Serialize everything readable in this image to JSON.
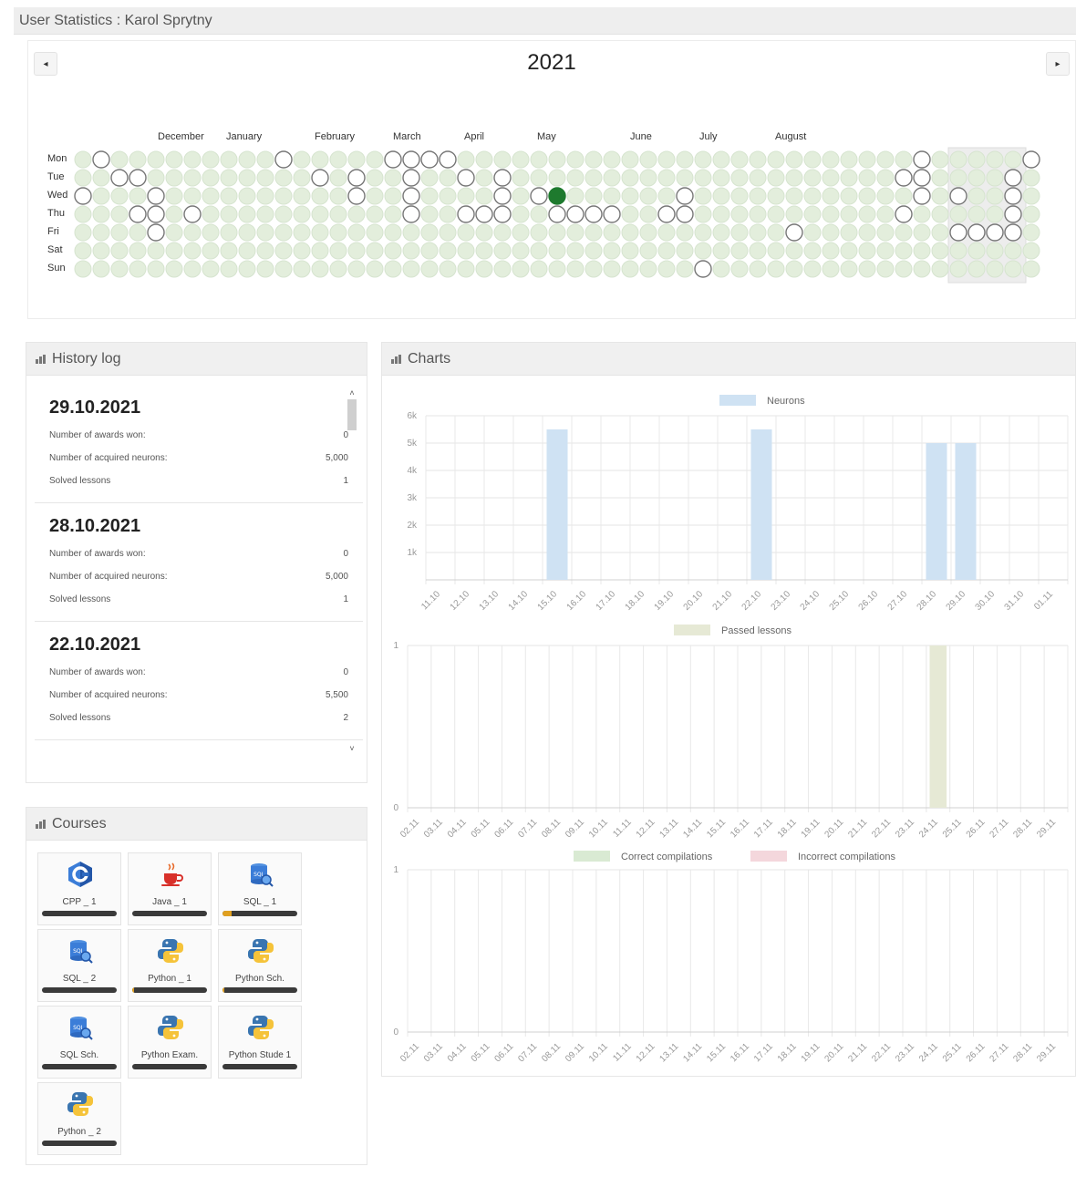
{
  "header": {
    "title": "User Statistics : Karol Sprytny"
  },
  "calendar": {
    "year": "2021",
    "prev_icon": "◂",
    "next_icon": "▸",
    "months": [
      "December",
      "January",
      "February",
      "March",
      "April",
      "May",
      "June",
      "July",
      "August"
    ],
    "days": [
      "Mon",
      "Tue",
      "Wed",
      "Thu",
      "Fri",
      "Sat",
      "Sun"
    ],
    "active_cells": [
      [
        1,
        0
      ],
      [
        2,
        1
      ],
      [
        3,
        1
      ],
      [
        0,
        2
      ],
      [
        4,
        2
      ],
      [
        3,
        3
      ],
      [
        4,
        3
      ],
      [
        6,
        3
      ],
      [
        4,
        4
      ],
      [
        11,
        0
      ],
      [
        13,
        1
      ],
      [
        15,
        1
      ],
      [
        15,
        2
      ],
      [
        17,
        0
      ],
      [
        18,
        0
      ],
      [
        19,
        0
      ],
      [
        20,
        0
      ],
      [
        18,
        1
      ],
      [
        18,
        2
      ],
      [
        18,
        3
      ],
      [
        21,
        1
      ],
      [
        23,
        1
      ],
      [
        23,
        2
      ],
      [
        21,
        3
      ],
      [
        22,
        3
      ],
      [
        23,
        3
      ],
      [
        25,
        2
      ],
      [
        26,
        3
      ],
      [
        27,
        3
      ],
      [
        28,
        3
      ],
      [
        29,
        3
      ],
      [
        33,
        2
      ],
      [
        32,
        3
      ],
      [
        33,
        3
      ],
      [
        34,
        6
      ],
      [
        39,
        4
      ],
      [
        45,
        1
      ],
      [
        46,
        0
      ],
      [
        46,
        1
      ],
      [
        46,
        2
      ],
      [
        45,
        3
      ],
      [
        48,
        2
      ],
      [
        48,
        4
      ],
      [
        49,
        4
      ],
      [
        50,
        4
      ],
      [
        51,
        1
      ],
      [
        51,
        2
      ],
      [
        51,
        3
      ],
      [
        51,
        4
      ],
      [
        52,
        0
      ]
    ],
    "highlight_cell": [
      26,
      2
    ],
    "colors": {
      "empty": "#e3eedc",
      "active_stroke": "#777777",
      "highlight": "#1e7a2e"
    }
  },
  "history": {
    "title": "History log",
    "entries": [
      {
        "date": "29.10.2021",
        "awards_label": "Number of awards won:",
        "awards": "0",
        "neurons_label": "Number of acquired neurons:",
        "neurons": "5,000",
        "lessons_label": "Solved lessons",
        "lessons": "1"
      },
      {
        "date": "28.10.2021",
        "awards_label": "Number of awards won:",
        "awards": "0",
        "neurons_label": "Number of acquired neurons:",
        "neurons": "5,000",
        "lessons_label": "Solved lessons",
        "lessons": "1"
      },
      {
        "date": "22.10.2021",
        "awards_label": "Number of awards won:",
        "awards": "0",
        "neurons_label": "Number of acquired neurons:",
        "neurons": "5,500",
        "lessons_label": "Solved lessons",
        "lessons": "2"
      }
    ],
    "scroll_up_icon": "˄",
    "scroll_down_icon": "˅"
  },
  "courses": {
    "title": "Courses",
    "items": [
      {
        "label": "CPP _ 1",
        "icon": "cpp-icon",
        "progress": 0
      },
      {
        "label": "Java _ 1",
        "icon": "java-icon",
        "progress": 0
      },
      {
        "label": "SQL _ 1",
        "icon": "sql-icon",
        "progress": 0.12
      },
      {
        "label": "SQL _ 2",
        "icon": "sql-icon",
        "progress": 0
      },
      {
        "label": "Python _ 1",
        "icon": "python-icon",
        "progress": 0.03
      },
      {
        "label": "Python Sch.",
        "icon": "python-icon",
        "progress": 0.03
      },
      {
        "label": "SQL Sch.",
        "icon": "sql-icon",
        "progress": 0
      },
      {
        "label": "Python Exam.",
        "icon": "python-icon",
        "progress": 0
      },
      {
        "label": "Python Stude 1",
        "icon": "python-icon",
        "progress": 0
      },
      {
        "label": "Python _ 2",
        "icon": "python-icon",
        "progress": 0
      }
    ]
  },
  "charts": {
    "title": "Charts"
  },
  "chart_data": [
    {
      "type": "bar",
      "series": [
        {
          "name": "Neurons",
          "color": "#cfe2f3",
          "values": [
            0,
            0,
            0,
            0,
            5500,
            0,
            0,
            0,
            0,
            0,
            0,
            5500,
            0,
            0,
            0,
            0,
            0,
            5000,
            5000,
            0,
            0,
            0
          ]
        }
      ],
      "categories": [
        "11.10",
        "12.10",
        "13.10",
        "14.10",
        "15.10",
        "16.10",
        "17.10",
        "18.10",
        "19.10",
        "20.10",
        "21.10",
        "22.10",
        "23.10",
        "24.10",
        "25.10",
        "26.10",
        "27.10",
        "28.10",
        "29.10",
        "30.10",
        "31.10",
        "01.11"
      ],
      "yticks": [
        "6k",
        "5k",
        "4k",
        "3k",
        "2k",
        "1k"
      ],
      "ylim": [
        0,
        6000
      ]
    },
    {
      "type": "bar",
      "series": [
        {
          "name": "Passed lessons",
          "color": "#e6e9d5",
          "values": [
            0,
            0,
            0,
            0,
            0,
            0,
            0,
            0,
            0,
            0,
            0,
            0,
            0,
            0,
            0,
            0,
            0,
            0,
            0,
            0,
            0,
            0,
            1,
            0,
            0,
            0,
            0,
            0
          ]
        }
      ],
      "categories": [
        "02.11",
        "03.11",
        "04.11",
        "05.11",
        "06.11",
        "07.11",
        "08.11",
        "09.11",
        "10.11",
        "11.11",
        "12.11",
        "13.11",
        "14.11",
        "15.11",
        "16.11",
        "17.11",
        "18.11",
        "19.11",
        "20.11",
        "21.11",
        "22.11",
        "23.11",
        "24.11",
        "25.11",
        "26.11",
        "27.11",
        "28.11",
        "29.11"
      ],
      "yticks": [
        "1",
        "0"
      ],
      "ylim": [
        0,
        1
      ]
    },
    {
      "type": "bar",
      "series": [
        {
          "name": "Correct compilations",
          "color": "#d9ead3",
          "values": [
            0,
            0,
            0,
            0,
            0,
            0,
            0,
            0,
            0,
            0,
            0,
            0,
            0,
            0,
            0,
            0,
            0,
            0,
            0,
            0,
            0,
            0,
            0,
            0,
            0,
            0,
            0
          ]
        },
        {
          "name": "Incorrect compilations",
          "color": "#f4d7dc",
          "values": [
            0,
            0,
            0,
            0,
            0,
            0,
            0,
            0,
            0,
            0,
            0,
            0,
            0,
            0,
            0,
            0,
            0,
            0,
            0,
            0,
            0,
            0,
            0,
            0,
            0,
            0,
            0
          ]
        }
      ],
      "categories": [
        "02.11",
        "03.11",
        "04.11",
        "05.11",
        "06.11",
        "07.11",
        "08.11",
        "09.11",
        "10.11",
        "11.11",
        "12.11",
        "13.11",
        "14.11",
        "15.11",
        "16.11",
        "17.11",
        "18.11",
        "19.11",
        "20.11",
        "21.11",
        "22.11",
        "23.11",
        "24.11",
        "25.11",
        "26.11",
        "27.11",
        "28.11",
        "29.11"
      ],
      "yticks": [
        "1",
        "0"
      ],
      "ylim": [
        0,
        1
      ]
    }
  ]
}
